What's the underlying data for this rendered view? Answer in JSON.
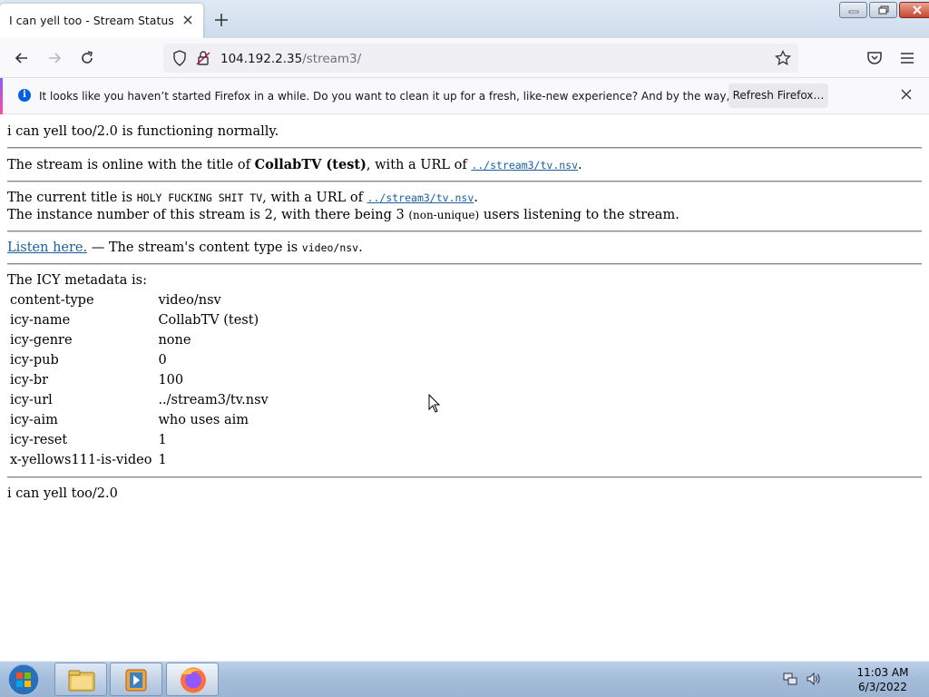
{
  "browser": {
    "tab_title": "I can yell too - Stream Status",
    "url_host": "104.192.2.35",
    "url_path": "/stream3/"
  },
  "notification": {
    "text": "It looks like you haven’t started Firefox in a while. Do you want to clean it up for a fresh, like-new experience? And by the way, welcome back!",
    "button": "Refresh Firefox…"
  },
  "page": {
    "status_line": "i can yell too/2.0 is functioning normally.",
    "online": {
      "prefix": "The stream is online with the title of ",
      "title": "CollabTV (test)",
      "mid": ", with a URL of ",
      "url": "../stream3/tv.nsv",
      "suffix": "."
    },
    "current": {
      "prefix": "The current title is ",
      "title": "HOLY FUCKING SHIT TV",
      "mid": ", with a URL of ",
      "url": "../stream3/tv.nsv",
      "suffix": "."
    },
    "instance": {
      "prefix": "The instance number of this stream is 2, with there being 3 ",
      "note": "(non-unique)",
      "suffix": " users listening to the stream."
    },
    "listen": {
      "link": "Listen here.",
      "mid": " — The stream's content type is ",
      "type": "video/nsv",
      "suffix": "."
    },
    "icy_heading": "The ICY metadata is:",
    "icy": [
      {
        "key": "content-type",
        "value": "video/nsv"
      },
      {
        "key": "icy-name",
        "value": "CollabTV (test)"
      },
      {
        "key": "icy-genre",
        "value": "none"
      },
      {
        "key": "icy-pub",
        "value": "0"
      },
      {
        "key": "icy-br",
        "value": "100"
      },
      {
        "key": "icy-url",
        "value": "../stream3/tv.nsv"
      },
      {
        "key": "icy-aim",
        "value": "who uses aim"
      },
      {
        "key": "icy-reset",
        "value": "1"
      },
      {
        "key": "x-yellows111-is-video",
        "value": "1"
      }
    ],
    "footer": "i can yell too/2.0"
  },
  "taskbar": {
    "time": "11:03 AM",
    "date": "6/3/2022",
    "items": [
      "start-orb-icon",
      "file-explorer-icon",
      "media-player-icon",
      "firefox-icon"
    ]
  }
}
